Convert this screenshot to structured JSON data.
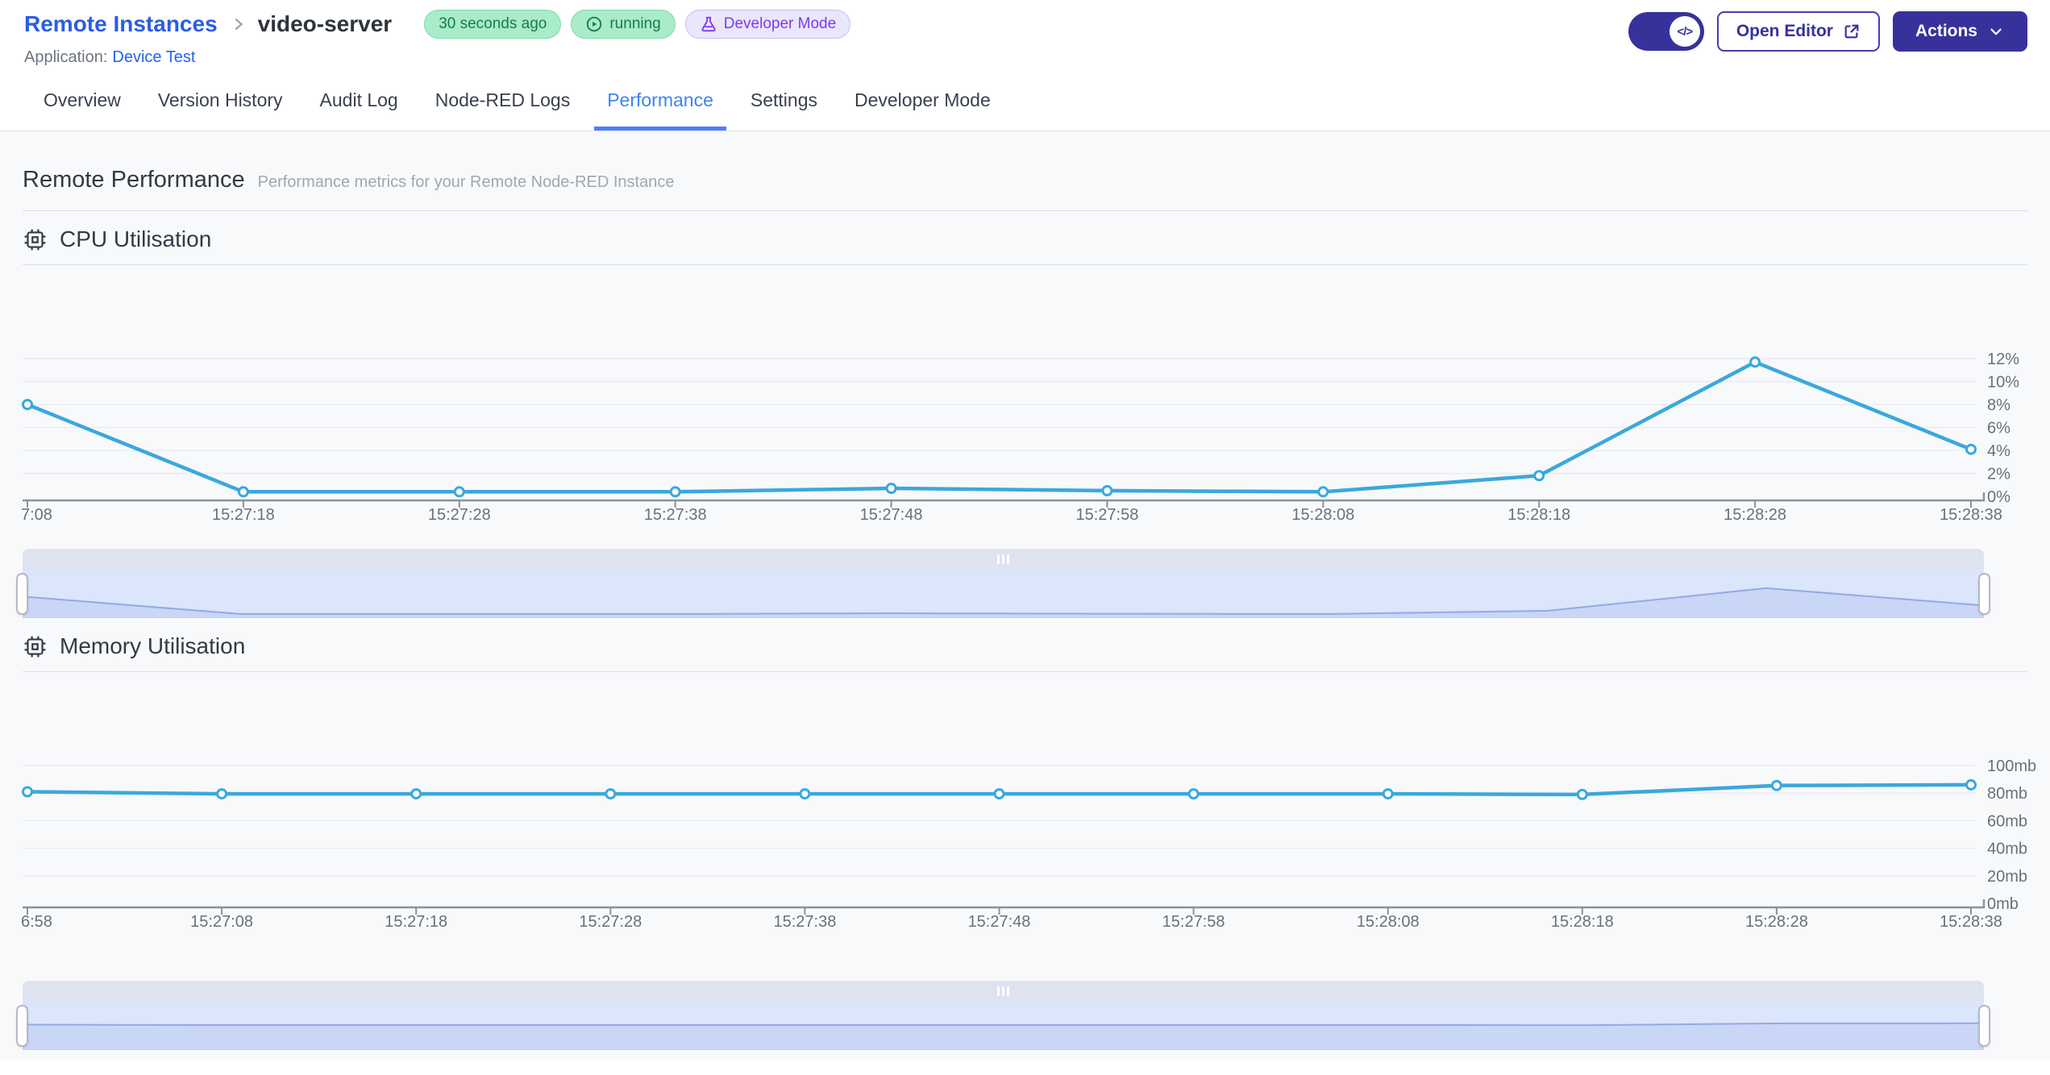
{
  "header": {
    "breadcrumb_root": "Remote Instances",
    "instance_name": "video-server",
    "badge_last_seen": "30 seconds ago",
    "badge_status": "running",
    "badge_mode": "Developer Mode",
    "application_label": "Application:",
    "application_name": "Device Test",
    "toggle_code_icon": "</>",
    "open_editor_label": "Open Editor",
    "actions_label": "Actions"
  },
  "tabs": [
    {
      "label": "Overview",
      "active": false
    },
    {
      "label": "Version History",
      "active": false
    },
    {
      "label": "Audit Log",
      "active": false
    },
    {
      "label": "Node-RED Logs",
      "active": false
    },
    {
      "label": "Performance",
      "active": true
    },
    {
      "label": "Settings",
      "active": false
    },
    {
      "label": "Developer Mode",
      "active": false
    }
  ],
  "page": {
    "title": "Remote Performance",
    "subtitle": "Performance metrics for your Remote Node-RED Instance"
  },
  "chart_data": [
    {
      "type": "line",
      "title": "CPU Utilisation",
      "x": [
        "7:08",
        "15:27:18",
        "15:27:28",
        "15:27:38",
        "15:27:48",
        "15:27:58",
        "15:28:08",
        "15:28:18",
        "15:28:28",
        "15:28:38"
      ],
      "values": [
        8,
        0.4,
        0.4,
        0.4,
        0.7,
        0.5,
        0.4,
        1.8,
        11.7,
        4.1
      ],
      "ytick_labels": [
        "12%",
        "10%",
        "8%",
        "6%",
        "4%",
        "2%",
        "0%"
      ],
      "ylim": [
        0,
        12
      ],
      "ylabel": "percent",
      "grid": true,
      "legend": "none",
      "yaxis_position": "right",
      "line_color": "#3aa8dc"
    },
    {
      "type": "line",
      "title": "Memory Utilisation",
      "x": [
        "6:58",
        "15:27:08",
        "15:27:18",
        "15:27:28",
        "15:27:38",
        "15:27:48",
        "15:27:58",
        "15:28:08",
        "15:28:18",
        "15:28:28",
        "15:28:38"
      ],
      "values": [
        81,
        79.5,
        79.5,
        79.5,
        79.5,
        79.5,
        79.5,
        79.5,
        79,
        85.5,
        86
      ],
      "ytick_labels": [
        "100mb",
        "80mb",
        "60mb",
        "40mb",
        "20mb",
        "0mb"
      ],
      "ylim": [
        0,
        100
      ],
      "ylabel": "mb",
      "grid": true,
      "legend": "none",
      "yaxis_position": "right",
      "line_color": "#3aa8dc"
    }
  ],
  "colors": {
    "accent_indigo": "#37329b",
    "link_blue": "#2b5ce7",
    "active_tab_blue": "#3e82f7",
    "chart_line_blue": "#3aa8dc",
    "badge_green_bg": "#a9ecc7",
    "badge_green_text": "#177a50",
    "badge_purple_bg": "#eae6fb",
    "badge_purple_text": "#7c3aed",
    "slider_band": "#dee3f0",
    "slider_body": "#dbe5fb",
    "slider_area_fill": "#c9d6f6"
  }
}
